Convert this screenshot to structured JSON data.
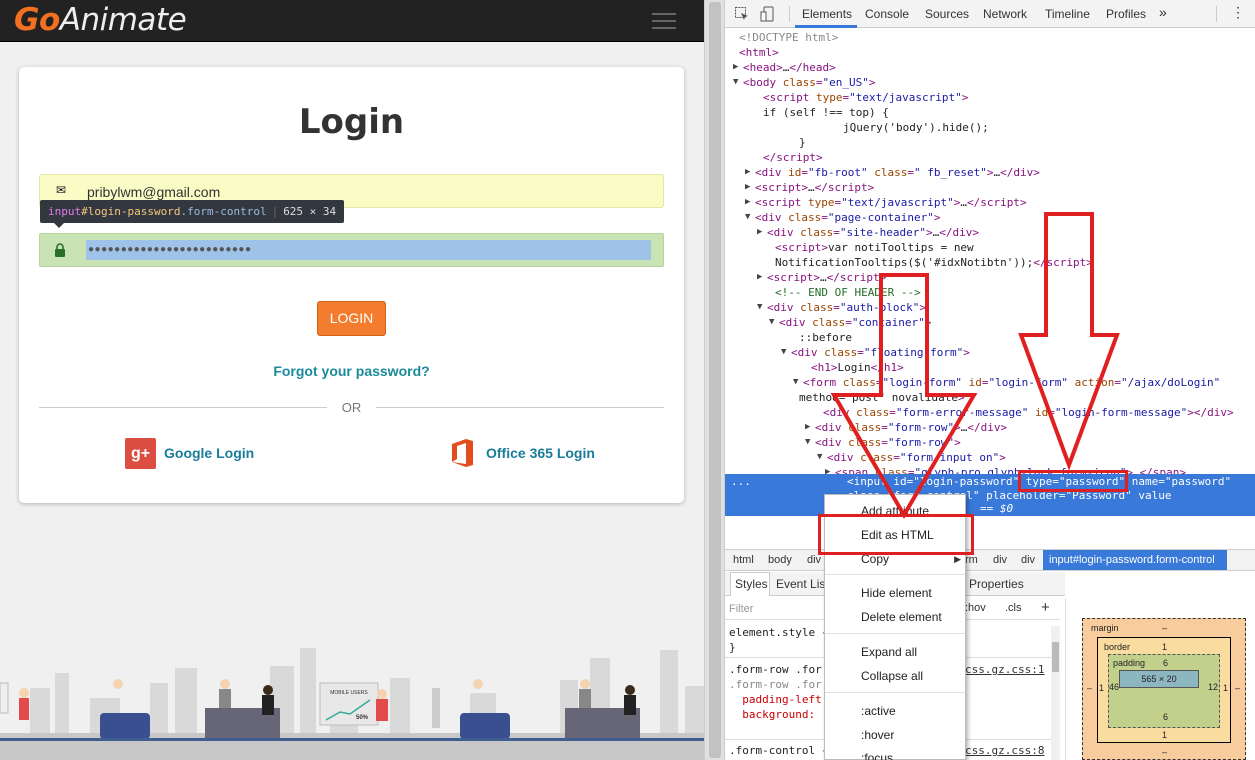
{
  "page": {
    "logo_go": "Go",
    "logo_animate": "Animate",
    "title": "Login",
    "email_value": "pribylwm@gmail.com",
    "password_dots": "●●●●●●●●●●●●●●●●●●●●●●●●●",
    "login_button": "LOGIN",
    "forgot": "Forgot your password?",
    "or": "OR",
    "google_login": "Google Login",
    "google_icon_text": "g+",
    "office_login": "Office 365 Login",
    "scene_label": "MOBILE USERS",
    "scene_value": "50%"
  },
  "tooltip": {
    "tag": "input",
    "id": "#login-password",
    "cls": ".form-control",
    "dims": "625 × 34"
  },
  "devtools": {
    "tabs": [
      "Elements",
      "Console",
      "Sources",
      "Network",
      "Timeline",
      "Profiles"
    ],
    "more": "»",
    "menu": "⋮",
    "tree": [
      "<!DOCTYPE html>",
      "<html>",
      "<head>…</head>",
      "<body class=\"en_US\">",
      "<script type=\"text/javascript\">",
      "if (self !== top) {",
      "jQuery('body').hide();",
      "}",
      "</script>",
      "<div id=\"fb-root\" class=\" fb_reset\">…</div>",
      "<script>…</script>",
      "<script type=\"text/javascript\">…</script>",
      "<div class=\"page-container\">",
      "<div class=\"site-header\">…</div>",
      "<script>var notiTooltips = new",
      "NotificationTooltips($('#idxNotibtn'));</script>",
      "<script>…</script>",
      "<!-- END OF HEADER -->",
      "<div class=\"auth-block\">",
      "<div class=\"container\">",
      "::before",
      "<div class=\"floating-form\">",
      "<h1>Login</h1>",
      "<form class=\"login-form\" id=\"login-form\" action=\"/ajax/doLogin\"",
      "method=\"post\" novalidate>",
      "<div class=\"form-error-message\" id=\"login-form-message\"></div>",
      "<div class=\"form-row\">…</div>",
      "<div class=\"form-row\">",
      "<div class=\"form-input on\">",
      "<span class=\"glyph-pro glyph-lock form-icon\">…</span>"
    ],
    "selected_line1": "<input id=\"login-password\" type=\"password\" name=\"password\"",
    "selected_line2": "class=\"form-control\" placeholder=\"Password\" value",
    "selected_line3": "== $0",
    "selected_dots": "...",
    "context_menu": [
      "Add attribute",
      "Edit as HTML",
      "Copy",
      "Hide element",
      "Delete element",
      "Expand all",
      "Collapse all",
      ":active",
      ":hover",
      ":focus"
    ],
    "breadcrumb": [
      "html",
      "body",
      "div",
      "rm",
      "div",
      "div"
    ],
    "breadcrumb_active": "input#login-password.form-control",
    "styles_tabs": [
      "Styles",
      "Event Listeners",
      "Properties"
    ],
    "filter_placeholder": "Filter",
    "hov": ":hov",
    "cls": ".cls",
    "plus": "+",
    "styles_lines": [
      "element.style {",
      "}",
      ".form-row .for",
      ".form-row .for",
      "  padding-left",
      "  background:",
      ".form-control {"
    ],
    "styles_src1": "css.gz.css:1",
    "styles_src2": "css.gz.css:8",
    "boxmodel": {
      "margin": "margin",
      "margin_val": "–",
      "border": "border",
      "border_val": "1",
      "padding": "padding",
      "padding_val": "6",
      "content": "565 × 20",
      "left_m": "–",
      "left_b": "1",
      "left_p": "46",
      "right_p": "12",
      "right_b": "1",
      "right_m": "–",
      "bottom_p": "6",
      "bottom_b": "1",
      "bottom_m": "–"
    }
  },
  "colors": {
    "accent": "#f47c2e",
    "link": "#1b7c9a",
    "devtools_select": "#3879d9",
    "annotation_red": "#e02020"
  }
}
